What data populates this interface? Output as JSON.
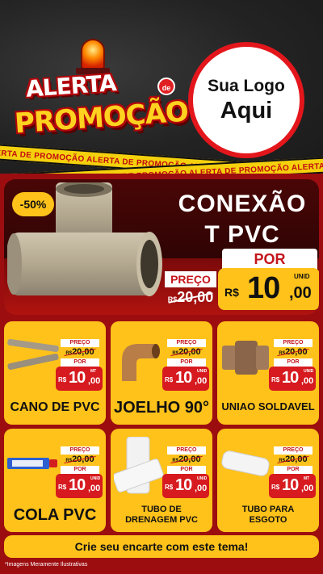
{
  "header": {
    "alerta": "ALERTA",
    "de": "de",
    "promocao": "PROMOÇÃO",
    "logo_line1": "Sua Logo",
    "logo_line2": "Aqui",
    "tape_text": "ALERTA DE PROMOÇÃO   ALERTA DE PROMOÇÃO   ALERTA DE PROMOÇÃO   ALERTA DE PROMOÇÃO"
  },
  "hero": {
    "discount": "-50%",
    "title_line1": "CONEXÃO",
    "title_line2": "T PVC",
    "preco_label": "PREÇO",
    "old_currency": "R$",
    "old_price": "20,00",
    "por_label": "POR",
    "currency": "R$",
    "price_int": "10",
    "price_dec": ",00",
    "unit": "UNID"
  },
  "products": [
    {
      "name": "CANO DE PVC",
      "preco": "PREÇO",
      "old_c": "R$",
      "old": "20,00",
      "por": "POR",
      "c": "R$",
      "int": "10",
      "dec": ",00",
      "unit": "MT"
    },
    {
      "name": "JOELHO 90°",
      "preco": "PREÇO",
      "old_c": "R$",
      "old": "20,00",
      "por": "POR",
      "c": "R$",
      "int": "10",
      "dec": ",00",
      "unit": "UNID"
    },
    {
      "name": "UNIAO SOLDAVEL",
      "preco": "PREÇO",
      "old_c": "R$",
      "old": "20,00",
      "por": "POR",
      "c": "R$",
      "int": "10",
      "dec": ",00",
      "unit": "UNID"
    },
    {
      "name": "COLA PVC",
      "preco": "PREÇO",
      "old_c": "R$",
      "old": "20,00",
      "por": "POR",
      "c": "R$",
      "int": "10",
      "dec": ",00",
      "unit": "UNID"
    },
    {
      "name_line1": "TUBO DE",
      "name_line2": "DRENAGEM PVC",
      "preco": "PREÇO",
      "old_c": "R$",
      "old": "20,00",
      "por": "POR",
      "c": "R$",
      "int": "10",
      "dec": ",00",
      "unit": "UNID"
    },
    {
      "name_line1": "TUBO PARA",
      "name_line2": "ESGOTO",
      "preco": "PREÇO",
      "old_c": "R$",
      "old": "20,00",
      "por": "POR",
      "c": "R$",
      "int": "10",
      "dec": ",00",
      "unit": "MT"
    }
  ],
  "footer": {
    "cta": "Crie seu encarte com este tema!",
    "disclaimer": "*Imagens Meramente Ilustrativas"
  },
  "colors": {
    "background_red": "#9c0d10",
    "yellow": "#ffc21a",
    "price_red": "#d61a1f",
    "pipe_beige": "#b6aa93"
  }
}
